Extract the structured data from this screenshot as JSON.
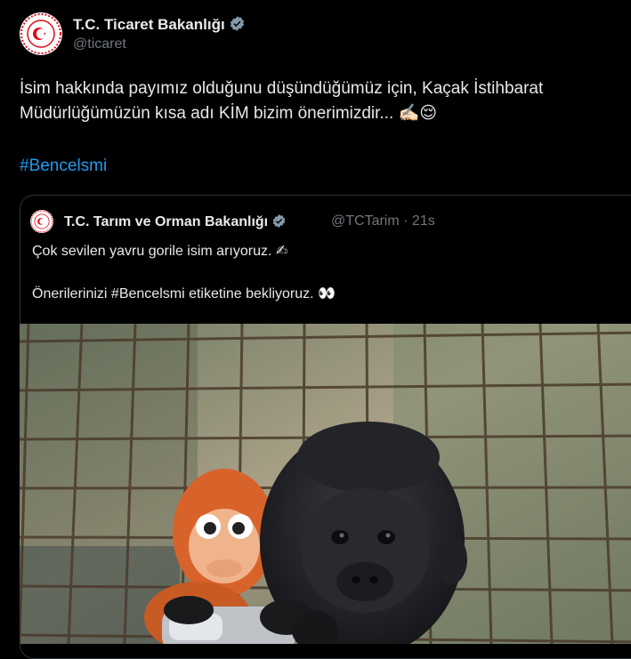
{
  "tweet": {
    "author_name": "T.C. Ticaret Bakanlığı",
    "author_handle": "@ticaret",
    "text_line1": "İsim hakkında payımız olduğunu düşündüğümüz için, Kaçak İstihbarat",
    "text_line2": "Müdürlüğümüzün kısa adı KİM bizim önerimizdir... ✍🏻😌",
    "hashtag": "#Bencelsmi"
  },
  "quoted": {
    "author_name": "T.C. Tarım ve Orman Bakanlığı",
    "author_handle": "@TCTarim",
    "separator": "·",
    "time": "21s",
    "line1": "Çok sevilen yavru gorile isim arıyoruz. ✍",
    "line2_prefix": "Önerilerinizi ",
    "line2_tag": "#Bencelsmi",
    "line2_suffix": " etiketine bekliyoruz. 👀"
  },
  "colors": {
    "background": "#000000",
    "text": "#e7e9ea",
    "muted": "#71767b",
    "link": "#1d9bf0",
    "verified": "#829aab"
  },
  "icons": [
    "verified-badge-icon",
    "turkish-emblem-avatar"
  ]
}
